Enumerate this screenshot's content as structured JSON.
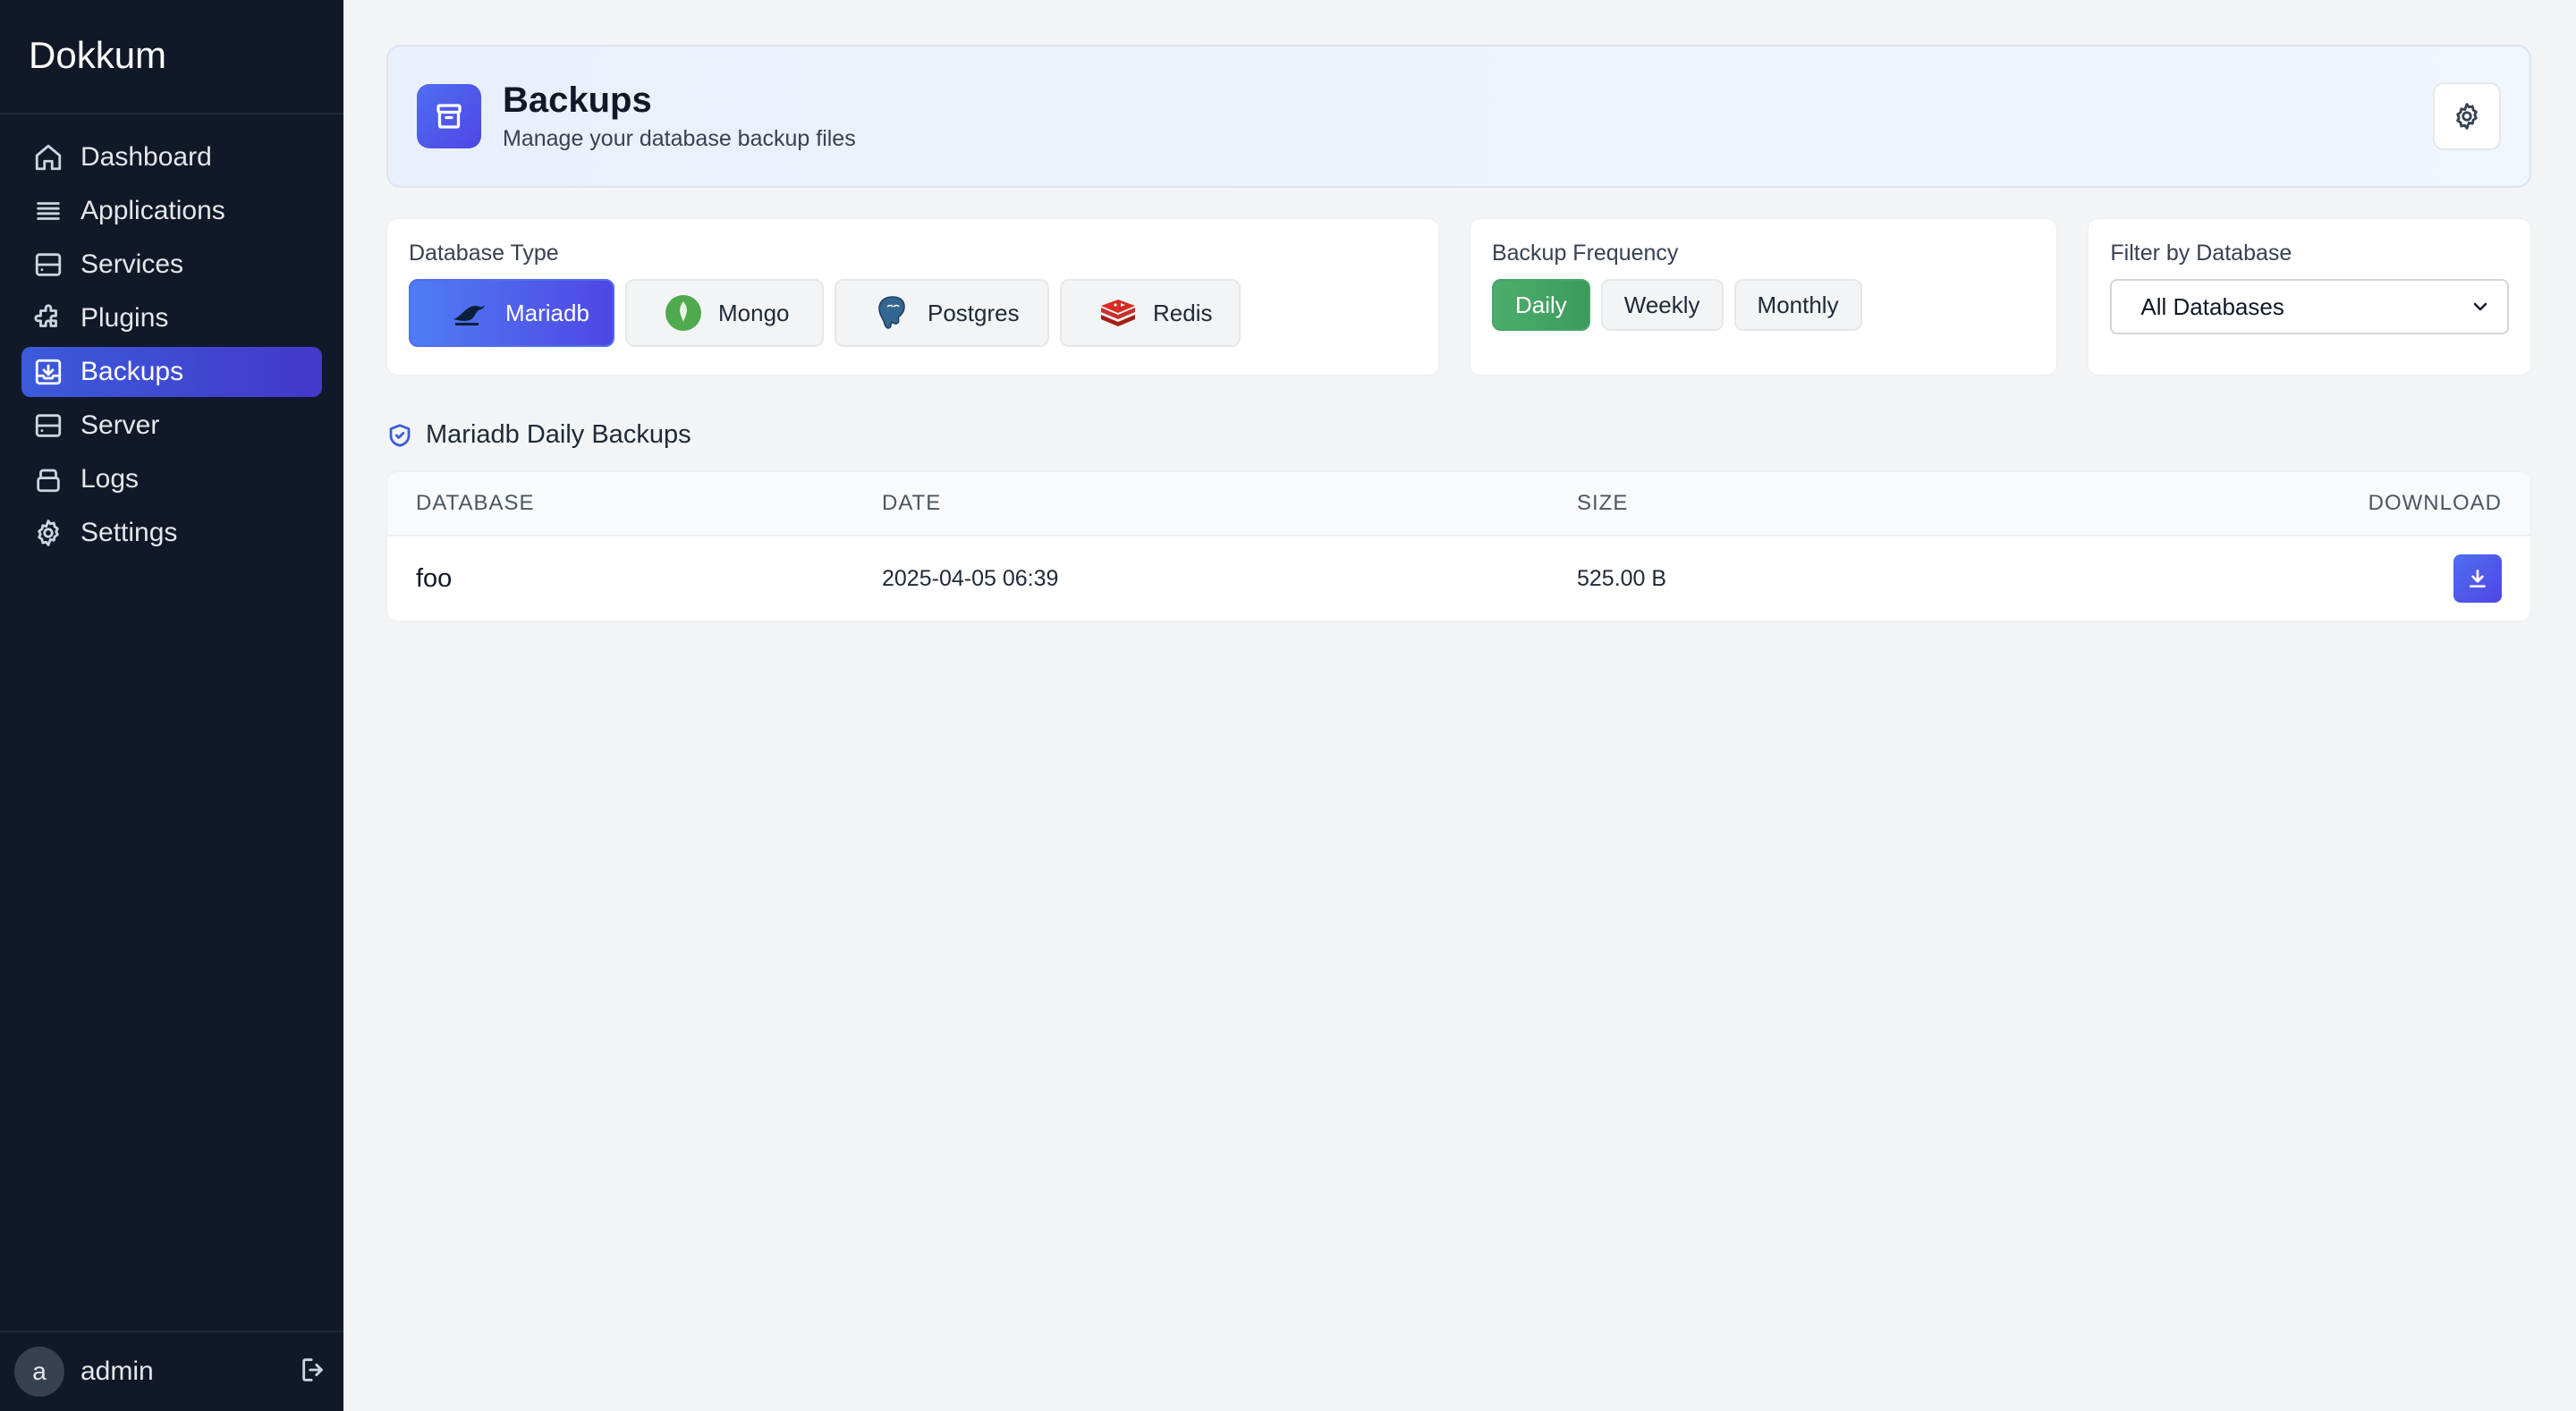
{
  "sidebar": {
    "brand": "Dokkum",
    "items": [
      {
        "label": "Dashboard",
        "icon": "home-icon"
      },
      {
        "label": "Applications",
        "icon": "list-icon"
      },
      {
        "label": "Services",
        "icon": "server-icon"
      },
      {
        "label": "Plugins",
        "icon": "puzzle-icon"
      },
      {
        "label": "Backups",
        "icon": "backup-icon",
        "active": true
      },
      {
        "label": "Server",
        "icon": "server-icon"
      },
      {
        "label": "Logs",
        "icon": "logs-icon"
      },
      {
        "label": "Settings",
        "icon": "gear-icon"
      }
    ],
    "user": {
      "avatar_letter": "a",
      "name": "admin"
    }
  },
  "header": {
    "title": "Backups",
    "subtitle": "Manage your database backup files"
  },
  "filters": {
    "database_type": {
      "label": "Database Type",
      "options": [
        "Mariadb",
        "Mongo",
        "Postgres",
        "Redis"
      ],
      "selected": "Mariadb"
    },
    "frequency": {
      "label": "Backup Frequency",
      "options": [
        "Daily",
        "Weekly",
        "Monthly"
      ],
      "selected": "Daily"
    },
    "database_filter": {
      "label": "Filter by Database",
      "value": "All Databases"
    }
  },
  "section": {
    "title": "Mariadb Daily Backups"
  },
  "table": {
    "columns": [
      "DATABASE",
      "DATE",
      "SIZE",
      "DOWNLOAD"
    ],
    "rows": [
      {
        "database": "foo",
        "date": "2025-04-05 06:39",
        "size": "525.00 B"
      }
    ]
  },
  "colors": {
    "accent": "#4f46e5",
    "success": "#3d9a5d",
    "sidebar_bg": "#111827"
  }
}
